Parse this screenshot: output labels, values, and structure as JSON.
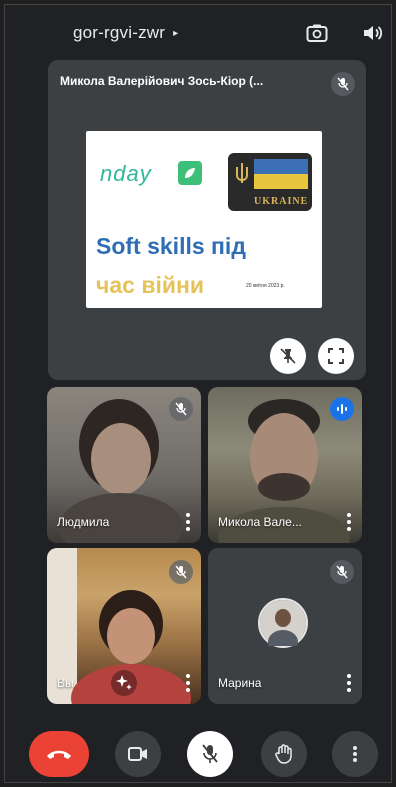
{
  "header": {
    "meeting_code": "gor-rgvi-zwr",
    "meeting_code_arrow": "▸"
  },
  "presentation": {
    "presenter_name": "Микола Валерійович Зось-Кіор (...",
    "slide": {
      "logo_text": "nday",
      "emblem_text": "UKRAINE",
      "title_line1": "Soft skills під",
      "title_line2": "час війни",
      "date": "20 квітня 2023 р."
    }
  },
  "participants": [
    {
      "name": "Людмила",
      "mic": "muted"
    },
    {
      "name": "Микола Вале...",
      "mic": "speaking"
    },
    {
      "name": "Вы",
      "mic": "muted"
    },
    {
      "name": "Марина",
      "mic": "muted"
    }
  ],
  "controls": {
    "end_call": "end-call-icon",
    "camera": "camera-icon",
    "mic": "mic-off-icon",
    "raise_hand": "hand-icon",
    "more": "more-vert-icon"
  },
  "colors": {
    "background": "#202124",
    "tile": "#3c4043",
    "end_call": "#ea4335",
    "speaking": "#1a73e8",
    "slide_title_blue": "#2f6db5",
    "slide_title_yellow": "#e6c25a",
    "logo_green": "#2db99a"
  }
}
